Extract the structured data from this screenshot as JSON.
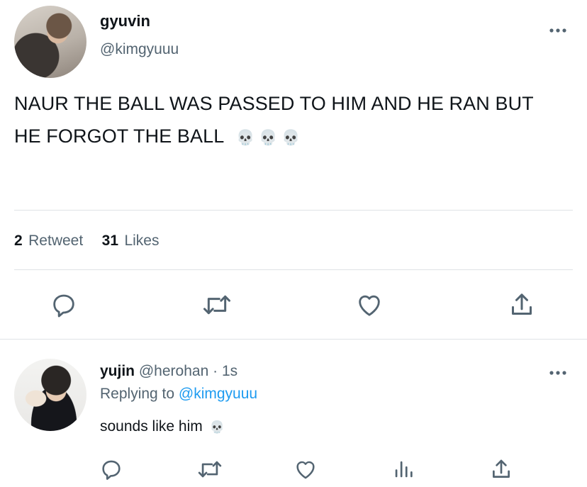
{
  "tweet": {
    "display_name": "gyuvin",
    "handle": "@kimgyuuu",
    "text": "NAUR THE BALL WAS PASSED TO HIM AND HE RAN BUT",
    "text_line2": "HE FORGOT THE BALL",
    "emoji": "💀 💀 💀",
    "retweet_count": "2",
    "retweet_label": "Retweet",
    "like_count": "31",
    "like_label": "Likes",
    "more_icon": "more-horizontal-icon"
  },
  "reply": {
    "display_name": "yujin",
    "handle": "@herohan",
    "separator": "·",
    "time": "1s",
    "replying_label": "Replying to",
    "replying_handle": "@kimgyuuu",
    "text": "sounds like him",
    "emoji": "💀"
  },
  "colors": {
    "text": "#0f1419",
    "secondary": "#536471",
    "accent": "#1d9bf0",
    "divider": "#dfe3e6"
  }
}
